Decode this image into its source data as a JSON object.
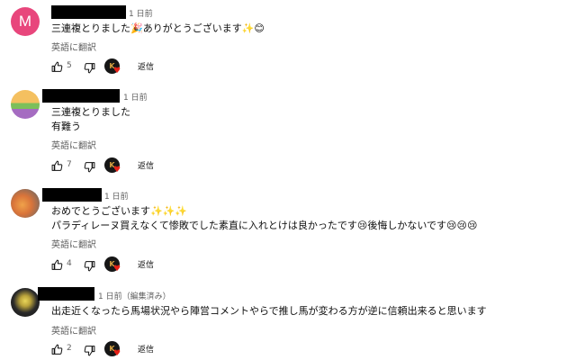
{
  "comments": [
    {
      "avatar_letter": "M",
      "time": "1 日前",
      "lines": [
        "三連複とりました🎉ありがとうございます✨😊"
      ],
      "translate": "英語に翻訳",
      "likes": "5",
      "reply": "返信"
    },
    {
      "avatar_letter": "",
      "time": "1 日前",
      "lines": [
        "三連複とりました",
        "有難う"
      ],
      "translate": "英語に翻訳",
      "likes": "7",
      "reply": "返信"
    },
    {
      "avatar_letter": "",
      "time": "1 日前",
      "lines": [
        "おめでとうございます✨✨✨",
        "パラディレーヌ買えなくて惨敗でした素直に入れとけは良かったです😢後悔しかないです😢😢😢"
      ],
      "translate": "英語に翻訳",
      "likes": "4",
      "reply": "返信"
    },
    {
      "avatar_letter": "",
      "time": "1 日前（編集済み）",
      "lines": [
        "出走近くなったら馬場状況やら陣営コメントやらで推し馬が変わる方が逆に信頼出来ると思います"
      ],
      "translate": "英語に翻訳",
      "likes": "2",
      "reply": "返信"
    }
  ],
  "creator_initial": "K",
  "colors": {
    "avatar_m": "#e8467c",
    "heart": "#e62117",
    "meta": "#606060"
  }
}
